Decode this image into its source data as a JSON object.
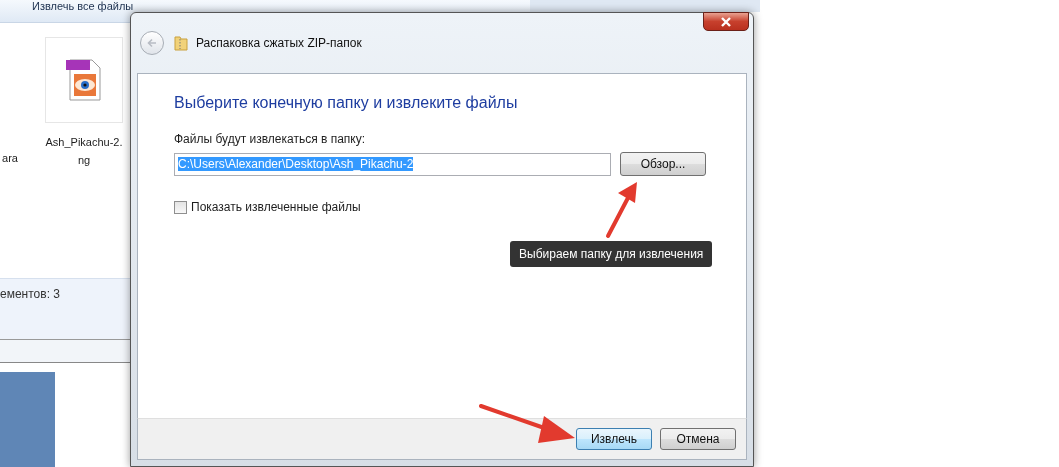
{
  "explorer": {
    "toolbar_button": "Извлечь все файлы",
    "items": [
      {
        "lines": [
          "ara"
        ],
        "kind": "cut"
      },
      {
        "lines": [
          "Ash_Pikachu-2.",
          "ng"
        ],
        "kind": "png"
      }
    ],
    "status": "ементов: 3"
  },
  "dialog": {
    "title": "Распаковка сжатых ZIP-папок",
    "heading": "Выберите конечную папку и извлеките файлы",
    "folder_label": "Файлы будут извлекаться в папку:",
    "path": {
      "value": "C:\\Users\\Alexander\\Desktop\\Ash_Pikachu-2",
      "selected": true
    },
    "browse_button": "Обзор...",
    "show_files": {
      "label": "Показать извлеченные файлы",
      "checked": false
    },
    "buttons": [
      {
        "label": "Извлечь",
        "default": true
      },
      {
        "label": "Отмена",
        "default": false
      }
    ]
  },
  "annotation": {
    "text": "Выбираем папку для извлечения"
  }
}
